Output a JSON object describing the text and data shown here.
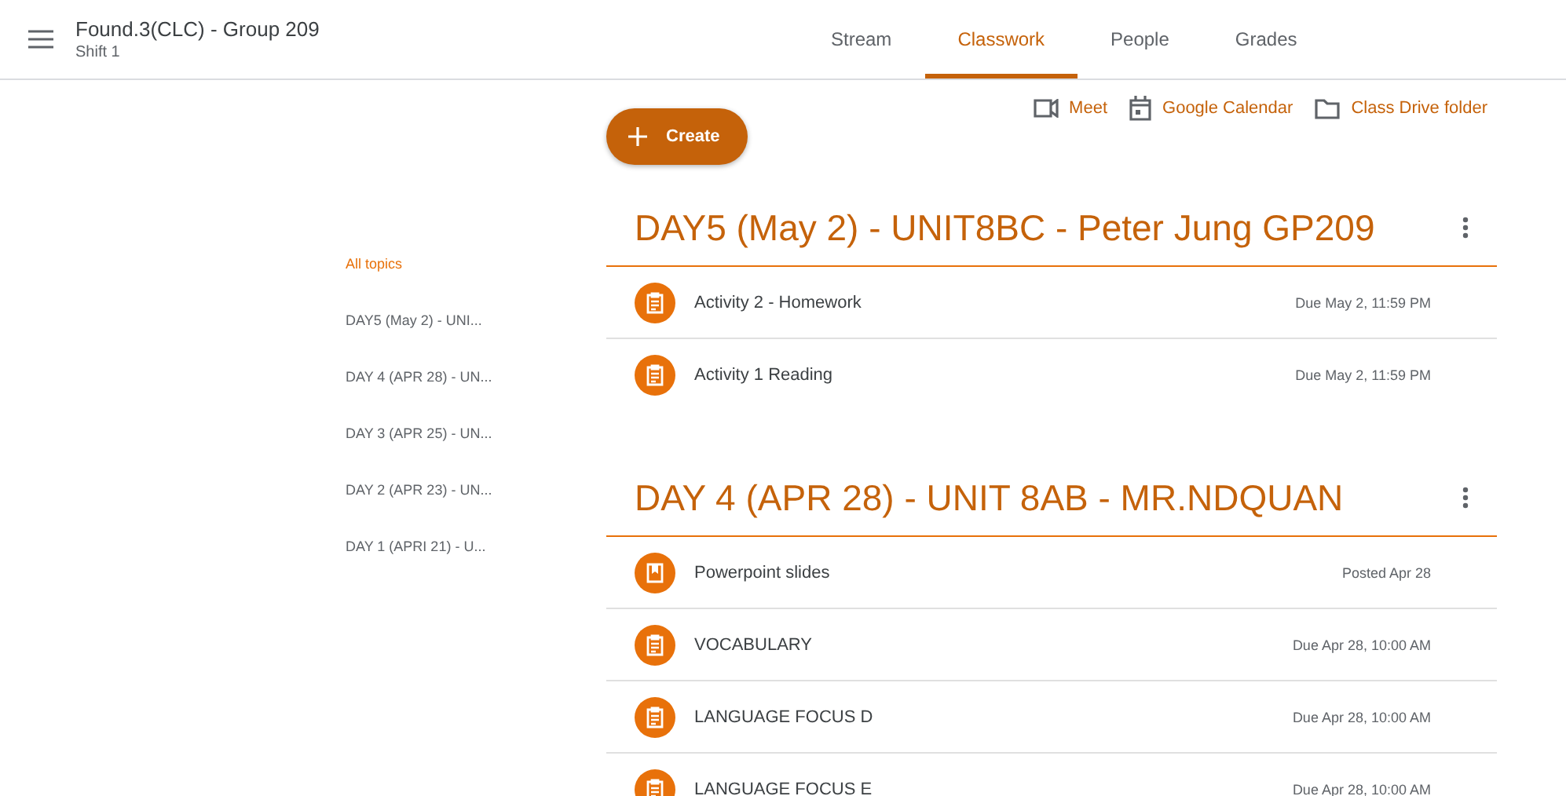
{
  "header": {
    "title": "Found.3(CLC) - Group 209",
    "subtitle": "Shift 1"
  },
  "tabs": [
    {
      "label": "Stream",
      "selected": false
    },
    {
      "label": "Classwork",
      "selected": true
    },
    {
      "label": "People",
      "selected": false
    },
    {
      "label": "Grades",
      "selected": false
    }
  ],
  "create_button": "Create",
  "links": [
    {
      "kind": "meet",
      "label": "Meet"
    },
    {
      "kind": "calendar",
      "label": "Google Calendar"
    },
    {
      "kind": "folder",
      "label": "Class Drive folder"
    }
  ],
  "topics": [
    {
      "label": "All topics",
      "selected": true
    },
    {
      "label": "DAY5 (May 2) - UNI...",
      "selected": false
    },
    {
      "label": "DAY 4 (APR 28) - UN...",
      "selected": false
    },
    {
      "label": "DAY 3 (APR 25) - UN...",
      "selected": false
    },
    {
      "label": "DAY 2 (APR 23) - UN...",
      "selected": false
    },
    {
      "label": "DAY 1 (APRI 21) - U...",
      "selected": false
    }
  ],
  "sections": [
    {
      "title": "DAY5 (May 2) - UNIT8BC - Peter Jung GP209",
      "items": [
        {
          "kind": "assignment",
          "title": "Activity 2 - Homework",
          "date": "Due May 2, 11:59 PM"
        },
        {
          "kind": "assignment",
          "title": "Activity 1 Reading",
          "date": "Due May 2, 11:59 PM"
        }
      ]
    },
    {
      "title": "DAY 4 (APR 28) - UNIT 8AB - MR.NDQUAN",
      "items": [
        {
          "kind": "material",
          "title": "Powerpoint slides",
          "date": "Posted Apr 28"
        },
        {
          "kind": "assignment",
          "title": "VOCABULARY",
          "date": "Due Apr 28, 10:00 AM"
        },
        {
          "kind": "assignment",
          "title": "LANGUAGE FOCUS D",
          "date": "Due Apr 28, 10:00 AM"
        },
        {
          "kind": "assignment",
          "title": "LANGUAGE FOCUS E",
          "date": "Due Apr 28, 10:00 AM"
        }
      ]
    }
  ]
}
